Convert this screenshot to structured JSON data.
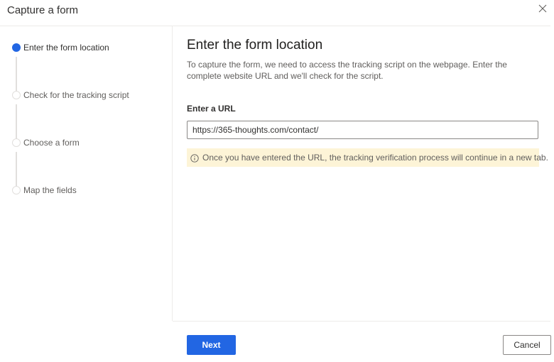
{
  "dialog": {
    "title": "Capture a form",
    "close_icon": "close-icon"
  },
  "steps": [
    {
      "label": "Enter the form location",
      "state": "active"
    },
    {
      "label": "Check for the tracking script",
      "state": "pending"
    },
    {
      "label": "Choose a form",
      "state": "pending"
    },
    {
      "label": "Map the fields",
      "state": "pending"
    }
  ],
  "main": {
    "title": "Enter the form location",
    "description": "To capture the form, we need to access the tracking script on the webpage. Enter the complete website URL and we'll check for the script.",
    "url_label": "Enter a URL",
    "url_value": "https://365-thoughts.com/contact/",
    "info_icon": "info-icon",
    "info_message": "Once you have entered the URL, the tracking verification process will continue in a new tab."
  },
  "footer": {
    "next_label": "Next",
    "cancel_label": "Cancel"
  },
  "colors": {
    "accent": "#2266e3",
    "info_background": "#fdf4d7",
    "divider": "#edebe9"
  }
}
